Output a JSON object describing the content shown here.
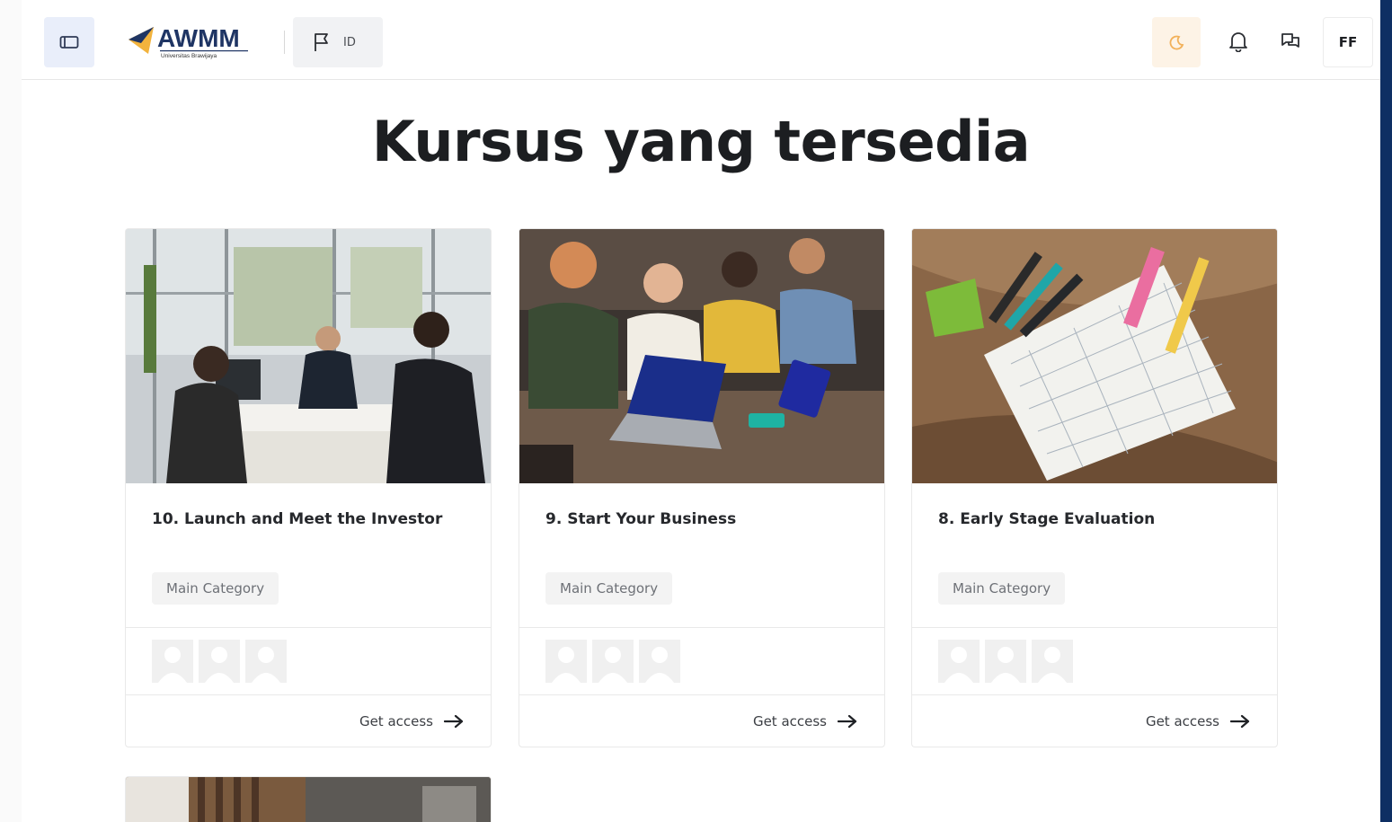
{
  "header": {
    "logo_text": "AWMM",
    "logo_subtitle": "Universitas Brawijaya",
    "language_code": "ID",
    "avatar_initials": "FF",
    "icons": {
      "sidebar_toggle": "sidebar-toggle-icon",
      "language": "flag-icon",
      "theme": "moon-icon",
      "notifications": "bell-icon",
      "messages": "chat-icon"
    },
    "colors": {
      "accent_blue": "#0e2f63",
      "sidebar_btn_bg": "#e9eefa",
      "theme_btn_bg": "#fdf3e6",
      "theme_icon": "#f2b15a"
    }
  },
  "main": {
    "title": "Kursus yang tersedia",
    "courses": [
      {
        "title": "10. Launch and Meet the Investor",
        "category": "Main Category",
        "action": "Get access"
      },
      {
        "title": "9. Start Your Business",
        "category": "Main Category",
        "action": "Get access"
      },
      {
        "title": "8. Early Stage Evaluation",
        "category": "Main Category",
        "action": "Get access"
      }
    ]
  }
}
